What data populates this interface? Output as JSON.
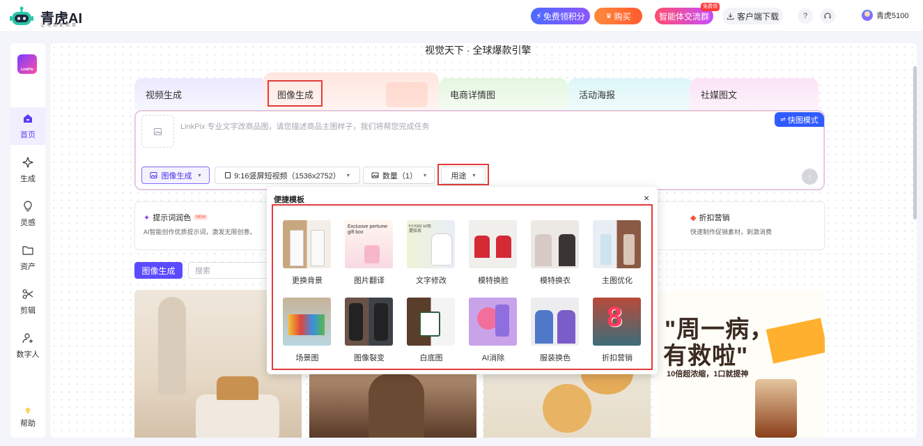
{
  "header": {
    "brand": "青虎AI",
    "slogan": "让电商更简单",
    "free_points": "免费领积分",
    "buy": "购买",
    "agent_group": "智能体交流群",
    "free_badge": "免费领",
    "client_download": "客户端下载",
    "help_icon": "?",
    "user_name": "青虎5100"
  },
  "sidebar": {
    "app_logo_text": "LinkPix",
    "items": [
      {
        "label": "首页",
        "icon": "home-icon",
        "active": true
      },
      {
        "label": "生成",
        "icon": "sparkle-icon"
      },
      {
        "label": "灵感",
        "icon": "bulb-icon"
      },
      {
        "label": "资产",
        "icon": "folder-icon"
      },
      {
        "label": "剪辑",
        "icon": "scissors-icon"
      },
      {
        "label": "数字人",
        "icon": "user-plus-icon"
      }
    ],
    "help": "帮助"
  },
  "main": {
    "slogan": "视觉天下 · 全球爆款引擎",
    "tabs": [
      {
        "label": "视频生成"
      },
      {
        "label": "图像生成",
        "active": true
      },
      {
        "label": "电商详情图"
      },
      {
        "label": "活动海报"
      },
      {
        "label": "社媒图文"
      }
    ],
    "prompt_placeholder": "LinkPix 专业文字改商品图，请您描述商品主图样子，我们将帮您完成任务",
    "fast_mode": "快图模式",
    "selects": {
      "mode": "图像生成",
      "ratio": "9:16竖屏短视频（1536x2752）",
      "count": "数量（1）",
      "use": "用途"
    },
    "features": [
      {
        "title": "提示词润色",
        "badge": "NEW",
        "desc": "AI智能创作优质提示词，激发无限创意。"
      },
      {
        "title": "折扣营销",
        "desc": "快速制作促销素材，刺激消费"
      }
    ],
    "filter_button": "图像生成",
    "search_placeholder": "搜索",
    "poster": {
      "line1": "\"周一病，",
      "line2": "有救啦\"",
      "line3": "10倍超浓缩，1口就提神"
    }
  },
  "popup": {
    "title": "便捷模板",
    "close": "×",
    "templates": [
      {
        "label": "更换背景"
      },
      {
        "label": "图片翻译",
        "thumb_text": "Exclusive perfume gift box"
      },
      {
        "label": "文字修改",
        "thumb_text": "FITGO 白色提拉衣"
      },
      {
        "label": "模特换脸"
      },
      {
        "label": "模特换衣"
      },
      {
        "label": "主图优化"
      },
      {
        "label": "场景图"
      },
      {
        "label": "图像裂变"
      },
      {
        "label": "白底图"
      },
      {
        "label": "AI消除"
      },
      {
        "label": "服装换色"
      },
      {
        "label": "折扣营销",
        "thumb_text": "8"
      }
    ]
  },
  "colors": {
    "accent": "#5b4bff",
    "highlight_box": "#e23b3b",
    "fast_mode": "#2f5bff"
  }
}
